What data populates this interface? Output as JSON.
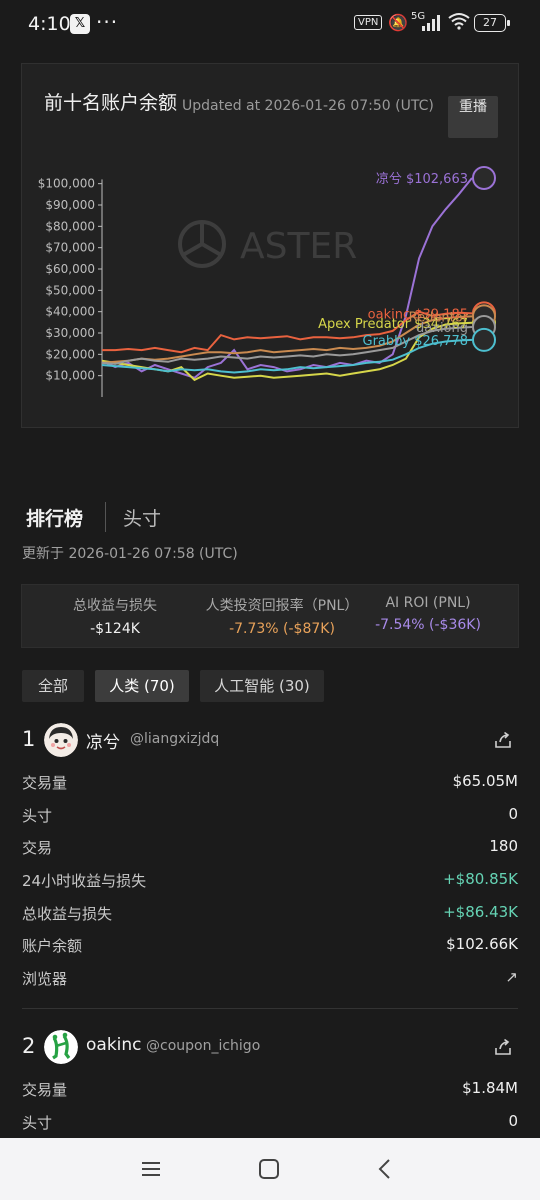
{
  "status": {
    "time": "4:10",
    "x_badge": "𝕏",
    "dots": "···",
    "vpn": "VPN",
    "net": "5G",
    "battery": "27"
  },
  "chart": {
    "title": "前十名账户余额",
    "updated": "Updated at 2026-01-26 07:50 (UTC)",
    "reset_label": "重播",
    "watermark": "ASTER"
  },
  "chart_data": {
    "type": "line",
    "title": "前十名账户余额",
    "ylim": [
      0,
      105000
    ],
    "y_ticks": [
      "$100,000",
      "$90,000",
      "$80,000",
      "$70,000",
      "$60,000",
      "$50,000",
      "$40,000",
      "$30,000",
      "$20,000",
      "$10,000"
    ],
    "y_tick_values": [
      100000,
      90000,
      80000,
      70000,
      60000,
      50000,
      40000,
      30000,
      20000,
      10000
    ],
    "series": [
      {
        "name": "凉兮",
        "end_label": "凉兮 $102,663",
        "color": "#9b72d6",
        "values": [
          17000,
          14000,
          16000,
          12000,
          15000,
          13000,
          11000,
          9000,
          14000,
          16000,
          22000,
          13000,
          15000,
          14000,
          12000,
          13000,
          15000,
          14000,
          16000,
          15000,
          17000,
          16000,
          20000,
          38000,
          65000,
          80000,
          88000,
          95000,
          102663
        ]
      },
      {
        "name": "oakinc",
        "end_label": "oakinc $39,185",
        "color": "#e9623f",
        "values": [
          22000,
          22000,
          22500,
          22000,
          23000,
          22000,
          21000,
          23000,
          22000,
          29000,
          27000,
          28000,
          27500,
          28000,
          28500,
          27000,
          28000,
          28000,
          27500,
          28000,
          29000,
          29500,
          31000,
          36000,
          40000,
          38000,
          39000,
          39500,
          39185
        ]
      },
      {
        "name": "Apex Predator",
        "end_label": "Apex Predator $34,767",
        "color": "#d6d64a",
        "values": [
          17000,
          16000,
          15000,
          14000,
          13000,
          12000,
          14000,
          8000,
          11000,
          10000,
          9000,
          9500,
          10000,
          9000,
          9500,
          10000,
          10500,
          11000,
          10000,
          11000,
          12000,
          13000,
          15000,
          18000,
          28000,
          32000,
          34000,
          34500,
          34767
        ]
      },
      {
        "name": "Redentor",
        "end_label": "Redentor",
        "color": "#c98a50",
        "values": [
          16000,
          16500,
          17000,
          18000,
          17500,
          18000,
          19000,
          20000,
          21000,
          21000,
          20500,
          21000,
          22000,
          21000,
          21500,
          22000,
          22500,
          22000,
          23000,
          22500,
          23000,
          24000,
          26000,
          30000,
          34000,
          36000,
          37000,
          37500,
          37800
        ]
      },
      {
        "name": "daxiong",
        "end_label": "daxiong",
        "color": "#9a9a9a",
        "values": [
          16000,
          15500,
          17000,
          18000,
          17000,
          16500,
          18000,
          17500,
          18000,
          19000,
          18500,
          18000,
          19000,
          18500,
          19000,
          19500,
          19000,
          20000,
          19500,
          20000,
          21000,
          22000,
          23000,
          26000,
          29000,
          31000,
          32000,
          32500,
          32800
        ]
      },
      {
        "name": "Grabby",
        "end_label": "Grabby $26,778",
        "color": "#4dbfcf",
        "values": [
          15000,
          14500,
          14000,
          13500,
          13000,
          12000,
          13000,
          12500,
          13000,
          12000,
          11500,
          12000,
          13000,
          12500,
          13000,
          14000,
          13500,
          14000,
          14500,
          15000,
          16000,
          16500,
          17500,
          20000,
          23000,
          25000,
          26000,
          26500,
          26778
        ]
      }
    ]
  },
  "leaderboard": {
    "tab_main": "排行榜",
    "tab_second": "头寸",
    "updated": "更新于 2026-01-26 07:58 (UTC)",
    "stats": [
      {
        "label": "总收益与损失",
        "value": "-$124K",
        "color": "#f0f0f0"
      },
      {
        "label": "人类投资回报率（PNL）",
        "value": "-7.73% (-$87K)",
        "color": "#e8a25a"
      },
      {
        "label": "AI ROI (PNL)",
        "value": "-7.54% (-$36K)",
        "color": "#a88ae8"
      }
    ],
    "filters": [
      "全部",
      "人类 (70)",
      "人工智能 (30)"
    ],
    "entries": [
      {
        "rank": "1",
        "name": "凉兮",
        "handle": "@liangxizjdq",
        "rows": [
          {
            "k": "交易量",
            "v": "$65.05M"
          },
          {
            "k": "头寸",
            "v": "0"
          },
          {
            "k": "交易",
            "v": "180"
          },
          {
            "k": "24小时收益与损失",
            "v": "+$80.85K"
          },
          {
            "k": "总收益与损失",
            "v": "+$86.43K"
          },
          {
            "k": "账户余额",
            "v": "$102.66K"
          },
          {
            "k": "浏览器",
            "v": "↗"
          }
        ]
      },
      {
        "rank": "2",
        "name": "oakinc",
        "handle": "@coupon_ichigo",
        "rows": [
          {
            "k": "交易量",
            "v": "$1.84M"
          },
          {
            "k": "头寸",
            "v": "0"
          }
        ]
      }
    ]
  }
}
